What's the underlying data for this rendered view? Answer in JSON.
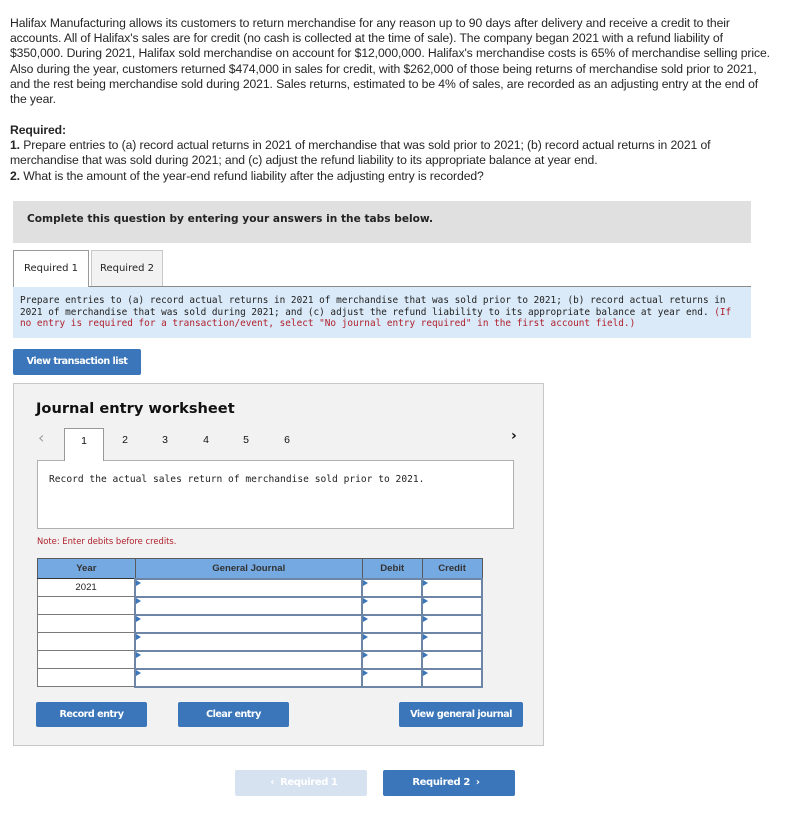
{
  "problem": {
    "text": "Halifax Manufacturing allows its customers to return merchandise for any reason up to 90 days after delivery and receive a credit to their accounts. All of Halifax's sales are for credit (no cash is collected at the time of sale). The company began 2021 with a refund liability of $350,000. During 2021, Halifax sold merchandise on account for $12,000,000. Halifax's merchandise costs is 65% of merchandise selling price. Also during the year, customers returned $474,000 in sales for credit, with $262,000 of those being returns of merchandise sold prior to 2021, and the rest being merchandise sold during 2021. Sales returns, estimated to be 4% of sales, are recorded as an adjusting entry at the end of the year."
  },
  "required": {
    "header": "Required:",
    "items": [
      {
        "num": "1.",
        "text": " Prepare entries to (a) record actual returns in 2021 of merchandise that was sold prior to 2021; (b) record actual returns in 2021 of merchandise that was sold during 2021; and (c) adjust the refund liability to its appropriate balance at year end."
      },
      {
        "num": "2.",
        "text": " What is the amount of the year-end refund liability after the adjusting entry is recorded?"
      }
    ]
  },
  "instruction_bar": "Complete this question by entering your answers in the tabs below.",
  "tabs": [
    {
      "label": "Required 1",
      "active": true
    },
    {
      "label": "Required 2",
      "active": false
    }
  ],
  "prompt": {
    "text": "Prepare entries to (a) record actual returns in 2021 of merchandise that was sold prior to 2021; (b) record actual returns in 2021 of merchandise that was sold during 2021; and (c) adjust the refund liability to its appropriate balance at year end. ",
    "note": "(If no entry is required for a transaction/event, select \"No journal entry required\" in the first account field.)"
  },
  "buttons": {
    "view_transaction_list": "View transaction list",
    "record_entry": "Record entry",
    "clear_entry": "Clear entry",
    "view_general_journal": "View general journal"
  },
  "worksheet": {
    "title": "Journal entry worksheet",
    "steps": [
      "1",
      "2",
      "3",
      "4",
      "5",
      "6"
    ],
    "active_step": "1",
    "prev_icon": "‹",
    "next_icon": "›",
    "description": "Record the actual sales return of merchandise sold prior to 2021.",
    "note": "Note: Enter debits before credits.",
    "table": {
      "headers": {
        "year": "Year",
        "general_journal": "General Journal",
        "debit": "Debit",
        "credit": "Credit"
      },
      "rows": [
        {
          "year": "2021",
          "account": "",
          "debit": "",
          "credit": ""
        },
        {
          "year": "",
          "account": "",
          "debit": "",
          "credit": ""
        },
        {
          "year": "",
          "account": "",
          "debit": "",
          "credit": ""
        },
        {
          "year": "",
          "account": "",
          "debit": "",
          "credit": ""
        },
        {
          "year": "",
          "account": "",
          "debit": "",
          "credit": ""
        },
        {
          "year": "",
          "account": "",
          "debit": "",
          "credit": ""
        }
      ]
    }
  },
  "navigation": {
    "prev_label": "Required 1",
    "next_label": "Required 2",
    "prev_icon": "‹",
    "next_icon": "›"
  }
}
